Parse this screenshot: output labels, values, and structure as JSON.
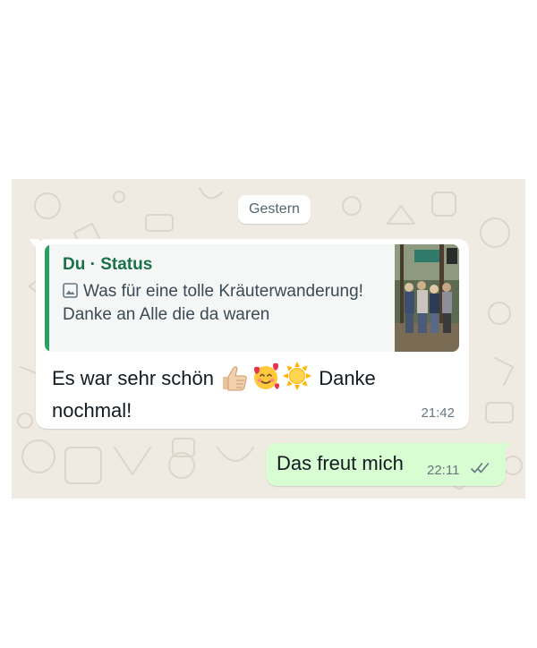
{
  "chat": {
    "date_separator": "Gestern",
    "incoming": {
      "quote_author": "Du · Status",
      "quote_text": "Was für eine tolle Kräuterwanderung! Danke an Alle die da waren",
      "text_before_emoji": "Es war sehr schön ",
      "emojis": [
        "thumbs-up",
        "smiling-face-with-hearts",
        "sun"
      ],
      "text_after_emoji": " Danke nochmal!",
      "time": "21:42"
    },
    "outgoing": {
      "text": "Das freut mich",
      "time": "22:11",
      "status": "read"
    }
  },
  "colors": {
    "chat_background": "#efeae2",
    "incoming_bubble": "#ffffff",
    "outgoing_bubble": "#d9fdd3",
    "quote_bar": "#25a262",
    "quote_author": "#1a7148",
    "meta_text": "#667781"
  },
  "icons": {
    "quote_media": "image-icon",
    "delivery": "double-check-icon"
  }
}
